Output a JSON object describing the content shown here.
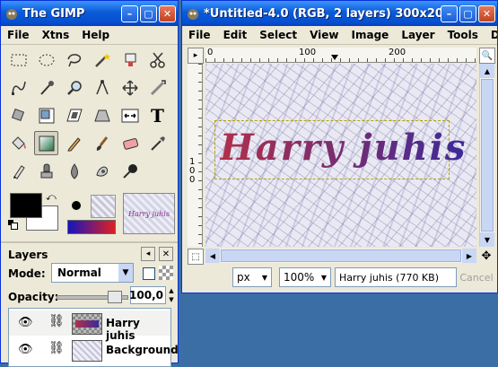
{
  "toolbox": {
    "title": "The GIMP",
    "menu": [
      "File",
      "Xtns",
      "Help"
    ],
    "tools": [
      "rect-select",
      "ellipse-select",
      "lasso",
      "fuzzy-select",
      "by-color-select",
      "scissors",
      "paths",
      "color-picker",
      "magnify",
      "measure",
      "move",
      "crop",
      "rotate",
      "scale",
      "shear",
      "perspective",
      "flip",
      "text",
      "bucket-fill",
      "blend",
      "pencil",
      "paintbrush",
      "eraser",
      "airbrush",
      "ink",
      "clone",
      "convolve",
      "smudge",
      "dodge-burn"
    ],
    "brush_thumb_text": "Harry juhis"
  },
  "layers": {
    "title": "Layers",
    "mode_label": "Mode:",
    "mode_value": "Normal",
    "opacity_label": "Opacity:",
    "opacity_value": "100,0",
    "items": [
      {
        "name": "Harry juhis",
        "selected": true
      },
      {
        "name": "Background",
        "selected": false
      }
    ]
  },
  "image_window": {
    "title": "*Untitled-4.0 (RGB, 2 layers) 300x200",
    "menu": [
      "File",
      "Edit",
      "Select",
      "View",
      "Image",
      "Layer",
      "Tools",
      "Dialogs"
    ],
    "ruler_labels": [
      "0",
      "100",
      "200"
    ],
    "vruler_labels": [
      "1",
      "0",
      "0"
    ],
    "canvas_text": "Harry juhis",
    "unit": "px",
    "zoom": "100%",
    "status": "Harry juhis (770 KB)",
    "cancel": "Cancel"
  },
  "colors": {
    "titlebar": "#0a5bd6",
    "chrome": "#ece9d8",
    "text_gradient_start": "#b0304a",
    "text_gradient_end": "#3c2a9a"
  }
}
